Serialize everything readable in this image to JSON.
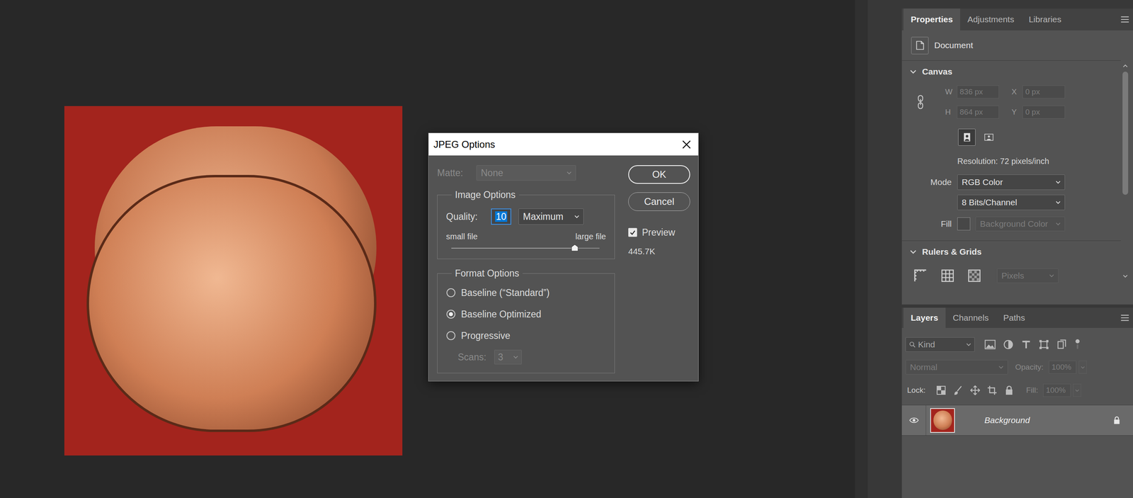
{
  "dialog": {
    "title": "JPEG Options",
    "matte": {
      "label": "Matte:",
      "value": "None",
      "disabled": true
    },
    "image_options": {
      "title": "Image Options",
      "quality_label": "Quality:",
      "quality": "10",
      "quality_selected": true,
      "preset": "Maximum",
      "small_label": "small file",
      "large_label": "large file",
      "level": 0.833
    },
    "format_options": {
      "title": "Format Options",
      "options": [
        {
          "label": "Baseline (“Standard”)",
          "selected": false
        },
        {
          "label": "Baseline Optimized",
          "selected": true
        },
        {
          "label": "Progressive",
          "selected": false
        }
      ],
      "scans_label": "Scans:",
      "scans": "3",
      "scans_disabled": true
    },
    "buttons": [
      {
        "label": "OK",
        "default": true
      },
      {
        "label": "Cancel",
        "default": false
      }
    ],
    "preview": {
      "label": "Preview",
      "checked": true
    },
    "file_size": "445.7K"
  },
  "properties": {
    "tabs": [
      {
        "label": "Properties",
        "selected": true
      },
      {
        "label": "Adjustments",
        "selected": false
      },
      {
        "label": "Libraries",
        "selected": false
      }
    ],
    "document_label": "Document",
    "canvas": {
      "title": "Canvas",
      "expanded": true,
      "fields": [
        {
          "label": "W",
          "value": "836 px",
          "disabled": true
        },
        {
          "label": "X",
          "value": "0 px",
          "disabled": true
        },
        {
          "label": "H",
          "value": "864 px",
          "disabled": true
        },
        {
          "label": "Y",
          "value": "0 px",
          "disabled": true
        }
      ],
      "orientation": [
        {
          "selected": true
        },
        {
          "selected": false
        }
      ],
      "resolution": "Resolution: 72 pixels/inch",
      "mode_label": "Mode",
      "mode": "RGB Color",
      "depth": "8 Bits/Channel",
      "fill_label": "Fill",
      "fill": {
        "value": "Background Color",
        "disabled": true
      }
    },
    "rulers": {
      "title": "Rulers & Grids",
      "expanded": true,
      "units": {
        "value": "Pixels",
        "disabled": true
      }
    }
  },
  "layers": {
    "tabs": [
      {
        "label": "Layers",
        "selected": true
      },
      {
        "label": "Channels",
        "selected": false
      },
      {
        "label": "Paths",
        "selected": false
      }
    ],
    "filter": "Kind",
    "blend_mode": {
      "value": "Normal",
      "disabled": true
    },
    "opacity": {
      "label": "Opacity:",
      "value": "100%",
      "disabled": true
    },
    "lock_label": "Lock:",
    "fill": {
      "label": "Fill:",
      "value": "100%",
      "disabled": true
    },
    "items": [
      {
        "name": "Background",
        "visible": true,
        "locked": true,
        "selected": true
      }
    ]
  }
}
